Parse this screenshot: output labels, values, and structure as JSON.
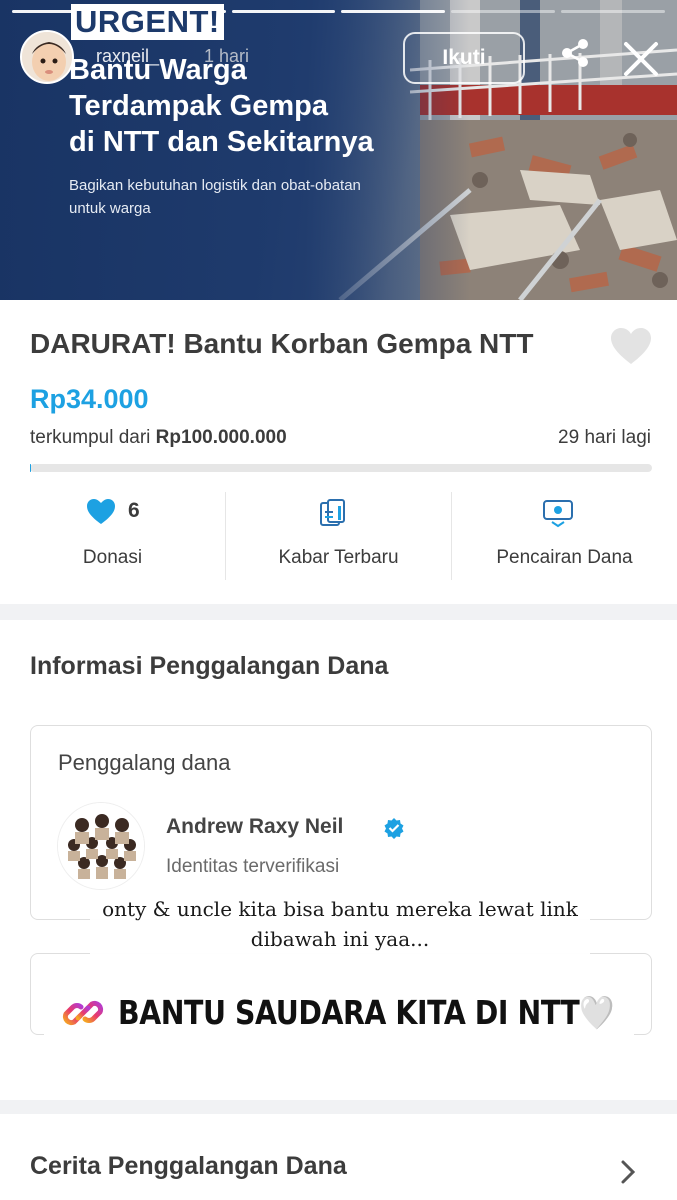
{
  "story": {
    "segments": 6,
    "username": "raxneil_",
    "time": "1 hari",
    "follow_label": "Ikuti"
  },
  "hero": {
    "badge": "URGENT!",
    "title_line1": "Bantu Warga",
    "title_line2": "Terdampak Gempa",
    "title_line3": "di NTT dan Sekitarnya",
    "subtitle": "Bagikan kebutuhan logistik dan obat-obatan untuk warga"
  },
  "campaign": {
    "title": "DARURAT! Bantu Korban Gempa NTT",
    "amount": "Rp34.000",
    "collected_prefix": "terkumpul dari ",
    "target": "Rp100.000.000",
    "days_left": "29 hari lagi",
    "progress_fraction": 0.00034,
    "stats": [
      {
        "label": "Donasi",
        "count": "6",
        "icon": "heart-icon"
      },
      {
        "label": "Kabar Terbaru",
        "icon": "document-icon"
      },
      {
        "label": "Pencairan Dana",
        "icon": "withdraw-icon"
      }
    ],
    "accent": "#1da1e2"
  },
  "info": {
    "section_title": "Informasi Penggalangan Dana",
    "fundraiser_label": "Penggalang dana",
    "fundraiser_name": "Andrew Raxy Neil",
    "fundraiser_status": "Identitas terverifikasi"
  },
  "overlay": {
    "caption_line1": "onty & uncle kita bisa bantu mereka lewat link",
    "caption_line2": "dibawah ini yaa...",
    "link_text": "BANTU SAUDARA KITA DI NTT🤍"
  },
  "story_section": {
    "title": "Cerita Penggalangan Dana"
  }
}
